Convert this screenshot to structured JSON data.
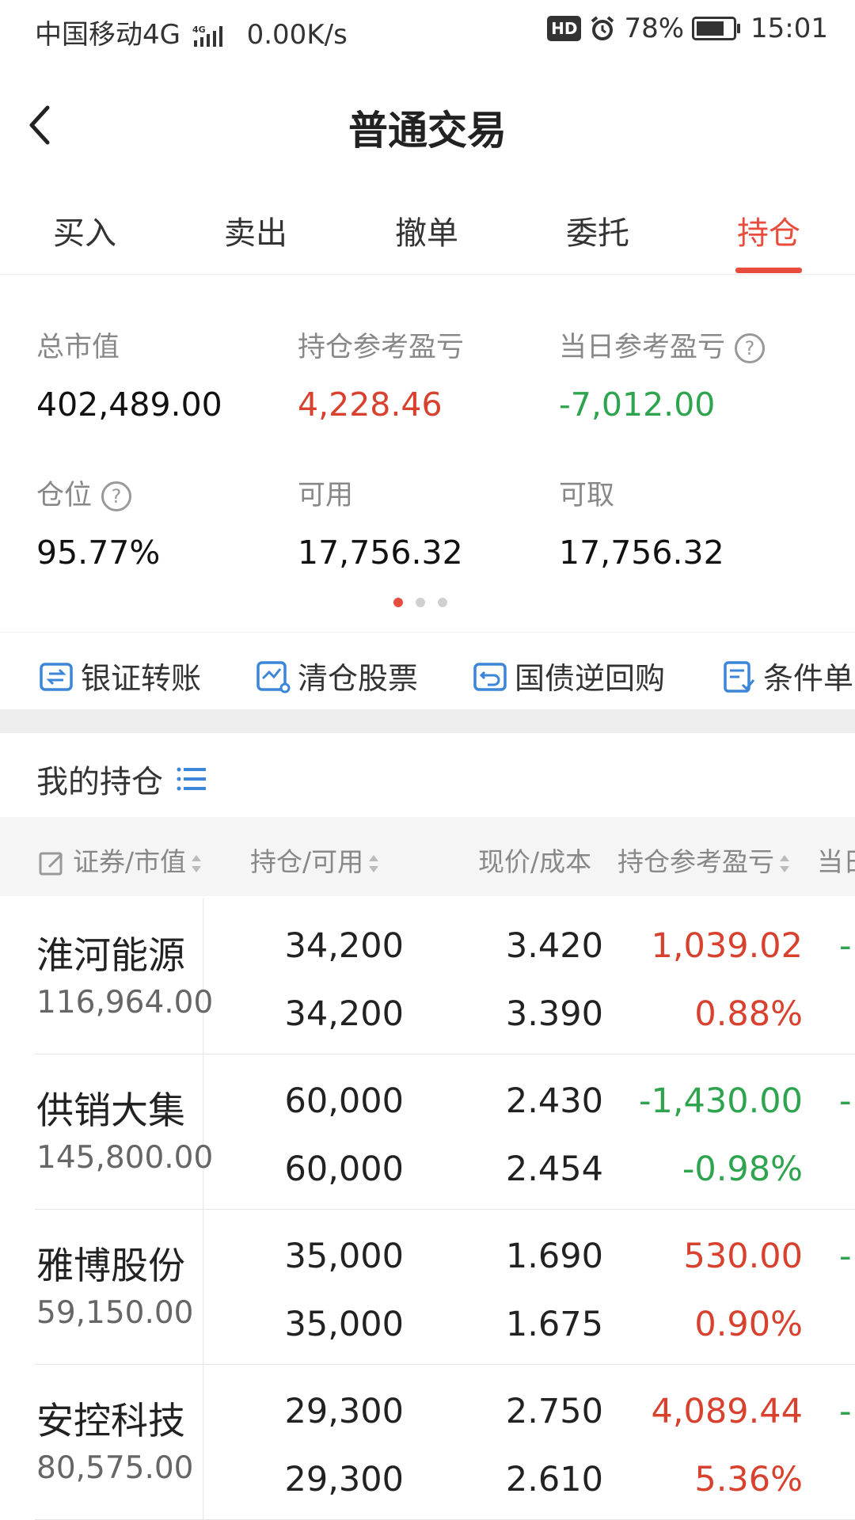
{
  "status_bar": {
    "carrier": "中国移动4G",
    "speed": "0.00K/s",
    "hd": "HD",
    "battery": "78%",
    "battery_level": 0.78,
    "time": "15:01"
  },
  "header": {
    "title": "普通交易"
  },
  "tabs": [
    {
      "label": "买入"
    },
    {
      "label": "卖出"
    },
    {
      "label": "撤单"
    },
    {
      "label": "委托"
    },
    {
      "label": "持仓",
      "active": true
    }
  ],
  "summary": {
    "total_value": {
      "label": "总市值",
      "value": "402,489.00"
    },
    "position_pnl": {
      "label": "持仓参考盈亏",
      "value": "4,228.46"
    },
    "daily_pnl": {
      "label": "当日参考盈亏",
      "value": "-7,012.00"
    },
    "position_ratio": {
      "label": "仓位",
      "value": "95.77%"
    },
    "available": {
      "label": "可用",
      "value": "17,756.32"
    },
    "withdrawable": {
      "label": "可取",
      "value": "17,756.32"
    },
    "help_symbol": "?"
  },
  "pager": {
    "count": 3,
    "active": 0
  },
  "quick_actions": [
    {
      "label": "银证转账"
    },
    {
      "label": "清仓股票"
    },
    {
      "label": "国债逆回购"
    },
    {
      "label": "条件单"
    }
  ],
  "holdings": {
    "title": "我的持仓",
    "columns": [
      "证券/市值",
      "持仓/可用",
      "现价/成本",
      "持仓参考盈亏",
      "当日"
    ],
    "rows": [
      {
        "name": "淮河能源",
        "market_value": "116,964.00",
        "position": "34,200",
        "available": "34,200",
        "price": "3.420",
        "cost": "3.390",
        "pnl": "1,039.02",
        "pnl_pct": "0.88%",
        "trend": "up",
        "daily": "-"
      },
      {
        "name": "供销大集",
        "market_value": "145,800.00",
        "position": "60,000",
        "available": "60,000",
        "price": "2.430",
        "cost": "2.454",
        "pnl": "-1,430.00",
        "pnl_pct": "-0.98%",
        "trend": "down",
        "daily": "-"
      },
      {
        "name": "雅博股份",
        "market_value": "59,150.00",
        "position": "35,000",
        "available": "35,000",
        "price": "1.690",
        "cost": "1.675",
        "pnl": "530.00",
        "pnl_pct": "0.90%",
        "trend": "up",
        "daily": "-"
      },
      {
        "name": "安控科技",
        "market_value": "80,575.00",
        "position": "29,300",
        "available": "29,300",
        "price": "2.750",
        "cost": "2.610",
        "pnl": "4,089.44",
        "pnl_pct": "5.36%",
        "trend": "up",
        "daily": "-"
      }
    ]
  },
  "colors": {
    "accent": "#e84c3d",
    "up": "#d9412f",
    "down": "#2ea44f",
    "icon_blue": "#3b86d8"
  }
}
